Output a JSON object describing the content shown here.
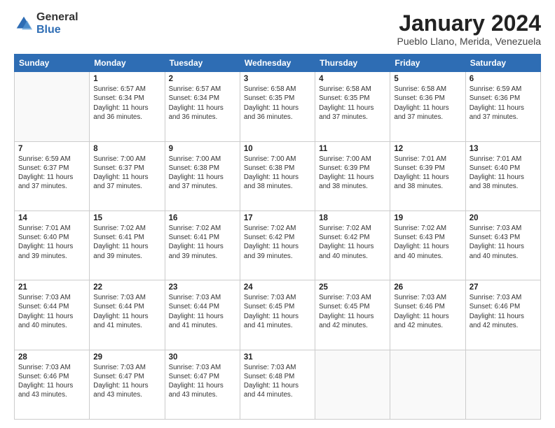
{
  "logo": {
    "general": "General",
    "blue": "Blue"
  },
  "title": "January 2024",
  "location": "Pueblo Llano, Merida, Venezuela",
  "days_header": [
    "Sunday",
    "Monday",
    "Tuesday",
    "Wednesday",
    "Thursday",
    "Friday",
    "Saturday"
  ],
  "weeks": [
    [
      {
        "day": "",
        "info": ""
      },
      {
        "day": "1",
        "info": "Sunrise: 6:57 AM\nSunset: 6:34 PM\nDaylight: 11 hours\nand 36 minutes."
      },
      {
        "day": "2",
        "info": "Sunrise: 6:57 AM\nSunset: 6:34 PM\nDaylight: 11 hours\nand 36 minutes."
      },
      {
        "day": "3",
        "info": "Sunrise: 6:58 AM\nSunset: 6:35 PM\nDaylight: 11 hours\nand 36 minutes."
      },
      {
        "day": "4",
        "info": "Sunrise: 6:58 AM\nSunset: 6:35 PM\nDaylight: 11 hours\nand 37 minutes."
      },
      {
        "day": "5",
        "info": "Sunrise: 6:58 AM\nSunset: 6:36 PM\nDaylight: 11 hours\nand 37 minutes."
      },
      {
        "day": "6",
        "info": "Sunrise: 6:59 AM\nSunset: 6:36 PM\nDaylight: 11 hours\nand 37 minutes."
      }
    ],
    [
      {
        "day": "7",
        "info": "Sunrise: 6:59 AM\nSunset: 6:37 PM\nDaylight: 11 hours\nand 37 minutes."
      },
      {
        "day": "8",
        "info": "Sunrise: 7:00 AM\nSunset: 6:37 PM\nDaylight: 11 hours\nand 37 minutes."
      },
      {
        "day": "9",
        "info": "Sunrise: 7:00 AM\nSunset: 6:38 PM\nDaylight: 11 hours\nand 37 minutes."
      },
      {
        "day": "10",
        "info": "Sunrise: 7:00 AM\nSunset: 6:38 PM\nDaylight: 11 hours\nand 38 minutes."
      },
      {
        "day": "11",
        "info": "Sunrise: 7:00 AM\nSunset: 6:39 PM\nDaylight: 11 hours\nand 38 minutes."
      },
      {
        "day": "12",
        "info": "Sunrise: 7:01 AM\nSunset: 6:39 PM\nDaylight: 11 hours\nand 38 minutes."
      },
      {
        "day": "13",
        "info": "Sunrise: 7:01 AM\nSunset: 6:40 PM\nDaylight: 11 hours\nand 38 minutes."
      }
    ],
    [
      {
        "day": "14",
        "info": "Sunrise: 7:01 AM\nSunset: 6:40 PM\nDaylight: 11 hours\nand 39 minutes."
      },
      {
        "day": "15",
        "info": "Sunrise: 7:02 AM\nSunset: 6:41 PM\nDaylight: 11 hours\nand 39 minutes."
      },
      {
        "day": "16",
        "info": "Sunrise: 7:02 AM\nSunset: 6:41 PM\nDaylight: 11 hours\nand 39 minutes."
      },
      {
        "day": "17",
        "info": "Sunrise: 7:02 AM\nSunset: 6:42 PM\nDaylight: 11 hours\nand 39 minutes."
      },
      {
        "day": "18",
        "info": "Sunrise: 7:02 AM\nSunset: 6:42 PM\nDaylight: 11 hours\nand 40 minutes."
      },
      {
        "day": "19",
        "info": "Sunrise: 7:02 AM\nSunset: 6:43 PM\nDaylight: 11 hours\nand 40 minutes."
      },
      {
        "day": "20",
        "info": "Sunrise: 7:03 AM\nSunset: 6:43 PM\nDaylight: 11 hours\nand 40 minutes."
      }
    ],
    [
      {
        "day": "21",
        "info": "Sunrise: 7:03 AM\nSunset: 6:44 PM\nDaylight: 11 hours\nand 40 minutes."
      },
      {
        "day": "22",
        "info": "Sunrise: 7:03 AM\nSunset: 6:44 PM\nDaylight: 11 hours\nand 41 minutes."
      },
      {
        "day": "23",
        "info": "Sunrise: 7:03 AM\nSunset: 6:44 PM\nDaylight: 11 hours\nand 41 minutes."
      },
      {
        "day": "24",
        "info": "Sunrise: 7:03 AM\nSunset: 6:45 PM\nDaylight: 11 hours\nand 41 minutes."
      },
      {
        "day": "25",
        "info": "Sunrise: 7:03 AM\nSunset: 6:45 PM\nDaylight: 11 hours\nand 42 minutes."
      },
      {
        "day": "26",
        "info": "Sunrise: 7:03 AM\nSunset: 6:46 PM\nDaylight: 11 hours\nand 42 minutes."
      },
      {
        "day": "27",
        "info": "Sunrise: 7:03 AM\nSunset: 6:46 PM\nDaylight: 11 hours\nand 42 minutes."
      }
    ],
    [
      {
        "day": "28",
        "info": "Sunrise: 7:03 AM\nSunset: 6:46 PM\nDaylight: 11 hours\nand 43 minutes."
      },
      {
        "day": "29",
        "info": "Sunrise: 7:03 AM\nSunset: 6:47 PM\nDaylight: 11 hours\nand 43 minutes."
      },
      {
        "day": "30",
        "info": "Sunrise: 7:03 AM\nSunset: 6:47 PM\nDaylight: 11 hours\nand 43 minutes."
      },
      {
        "day": "31",
        "info": "Sunrise: 7:03 AM\nSunset: 6:48 PM\nDaylight: 11 hours\nand 44 minutes."
      },
      {
        "day": "",
        "info": ""
      },
      {
        "day": "",
        "info": ""
      },
      {
        "day": "",
        "info": ""
      }
    ]
  ]
}
